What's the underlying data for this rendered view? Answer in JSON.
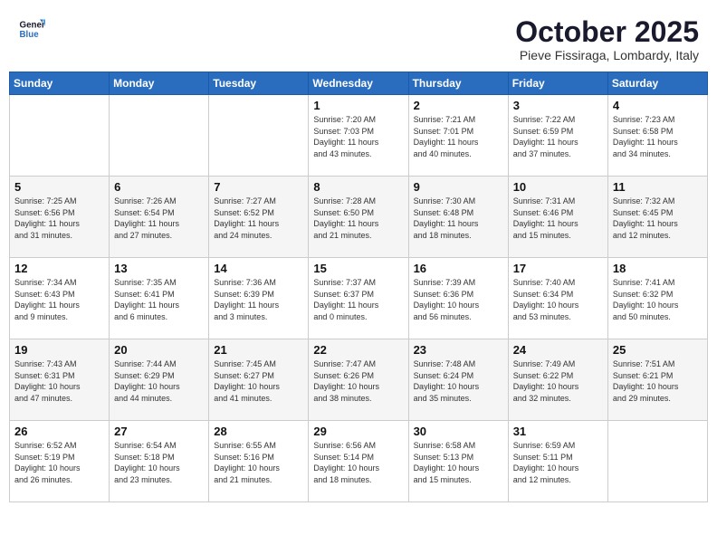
{
  "logo": {
    "line1": "General",
    "line2": "Blue"
  },
  "header": {
    "month": "October 2025",
    "location": "Pieve Fissiraga, Lombardy, Italy"
  },
  "weekdays": [
    "Sunday",
    "Monday",
    "Tuesday",
    "Wednesday",
    "Thursday",
    "Friday",
    "Saturday"
  ],
  "weeks": [
    [
      {
        "day": "",
        "info": ""
      },
      {
        "day": "",
        "info": ""
      },
      {
        "day": "",
        "info": ""
      },
      {
        "day": "1",
        "info": "Sunrise: 7:20 AM\nSunset: 7:03 PM\nDaylight: 11 hours\nand 43 minutes."
      },
      {
        "day": "2",
        "info": "Sunrise: 7:21 AM\nSunset: 7:01 PM\nDaylight: 11 hours\nand 40 minutes."
      },
      {
        "day": "3",
        "info": "Sunrise: 7:22 AM\nSunset: 6:59 PM\nDaylight: 11 hours\nand 37 minutes."
      },
      {
        "day": "4",
        "info": "Sunrise: 7:23 AM\nSunset: 6:58 PM\nDaylight: 11 hours\nand 34 minutes."
      }
    ],
    [
      {
        "day": "5",
        "info": "Sunrise: 7:25 AM\nSunset: 6:56 PM\nDaylight: 11 hours\nand 31 minutes."
      },
      {
        "day": "6",
        "info": "Sunrise: 7:26 AM\nSunset: 6:54 PM\nDaylight: 11 hours\nand 27 minutes."
      },
      {
        "day": "7",
        "info": "Sunrise: 7:27 AM\nSunset: 6:52 PM\nDaylight: 11 hours\nand 24 minutes."
      },
      {
        "day": "8",
        "info": "Sunrise: 7:28 AM\nSunset: 6:50 PM\nDaylight: 11 hours\nand 21 minutes."
      },
      {
        "day": "9",
        "info": "Sunrise: 7:30 AM\nSunset: 6:48 PM\nDaylight: 11 hours\nand 18 minutes."
      },
      {
        "day": "10",
        "info": "Sunrise: 7:31 AM\nSunset: 6:46 PM\nDaylight: 11 hours\nand 15 minutes."
      },
      {
        "day": "11",
        "info": "Sunrise: 7:32 AM\nSunset: 6:45 PM\nDaylight: 11 hours\nand 12 minutes."
      }
    ],
    [
      {
        "day": "12",
        "info": "Sunrise: 7:34 AM\nSunset: 6:43 PM\nDaylight: 11 hours\nand 9 minutes."
      },
      {
        "day": "13",
        "info": "Sunrise: 7:35 AM\nSunset: 6:41 PM\nDaylight: 11 hours\nand 6 minutes."
      },
      {
        "day": "14",
        "info": "Sunrise: 7:36 AM\nSunset: 6:39 PM\nDaylight: 11 hours\nand 3 minutes."
      },
      {
        "day": "15",
        "info": "Sunrise: 7:37 AM\nSunset: 6:37 PM\nDaylight: 11 hours\nand 0 minutes."
      },
      {
        "day": "16",
        "info": "Sunrise: 7:39 AM\nSunset: 6:36 PM\nDaylight: 10 hours\nand 56 minutes."
      },
      {
        "day": "17",
        "info": "Sunrise: 7:40 AM\nSunset: 6:34 PM\nDaylight: 10 hours\nand 53 minutes."
      },
      {
        "day": "18",
        "info": "Sunrise: 7:41 AM\nSunset: 6:32 PM\nDaylight: 10 hours\nand 50 minutes."
      }
    ],
    [
      {
        "day": "19",
        "info": "Sunrise: 7:43 AM\nSunset: 6:31 PM\nDaylight: 10 hours\nand 47 minutes."
      },
      {
        "day": "20",
        "info": "Sunrise: 7:44 AM\nSunset: 6:29 PM\nDaylight: 10 hours\nand 44 minutes."
      },
      {
        "day": "21",
        "info": "Sunrise: 7:45 AM\nSunset: 6:27 PM\nDaylight: 10 hours\nand 41 minutes."
      },
      {
        "day": "22",
        "info": "Sunrise: 7:47 AM\nSunset: 6:26 PM\nDaylight: 10 hours\nand 38 minutes."
      },
      {
        "day": "23",
        "info": "Sunrise: 7:48 AM\nSunset: 6:24 PM\nDaylight: 10 hours\nand 35 minutes."
      },
      {
        "day": "24",
        "info": "Sunrise: 7:49 AM\nSunset: 6:22 PM\nDaylight: 10 hours\nand 32 minutes."
      },
      {
        "day": "25",
        "info": "Sunrise: 7:51 AM\nSunset: 6:21 PM\nDaylight: 10 hours\nand 29 minutes."
      }
    ],
    [
      {
        "day": "26",
        "info": "Sunrise: 6:52 AM\nSunset: 5:19 PM\nDaylight: 10 hours\nand 26 minutes."
      },
      {
        "day": "27",
        "info": "Sunrise: 6:54 AM\nSunset: 5:18 PM\nDaylight: 10 hours\nand 23 minutes."
      },
      {
        "day": "28",
        "info": "Sunrise: 6:55 AM\nSunset: 5:16 PM\nDaylight: 10 hours\nand 21 minutes."
      },
      {
        "day": "29",
        "info": "Sunrise: 6:56 AM\nSunset: 5:14 PM\nDaylight: 10 hours\nand 18 minutes."
      },
      {
        "day": "30",
        "info": "Sunrise: 6:58 AM\nSunset: 5:13 PM\nDaylight: 10 hours\nand 15 minutes."
      },
      {
        "day": "31",
        "info": "Sunrise: 6:59 AM\nSunset: 5:11 PM\nDaylight: 10 hours\nand 12 minutes."
      },
      {
        "day": "",
        "info": ""
      }
    ]
  ]
}
